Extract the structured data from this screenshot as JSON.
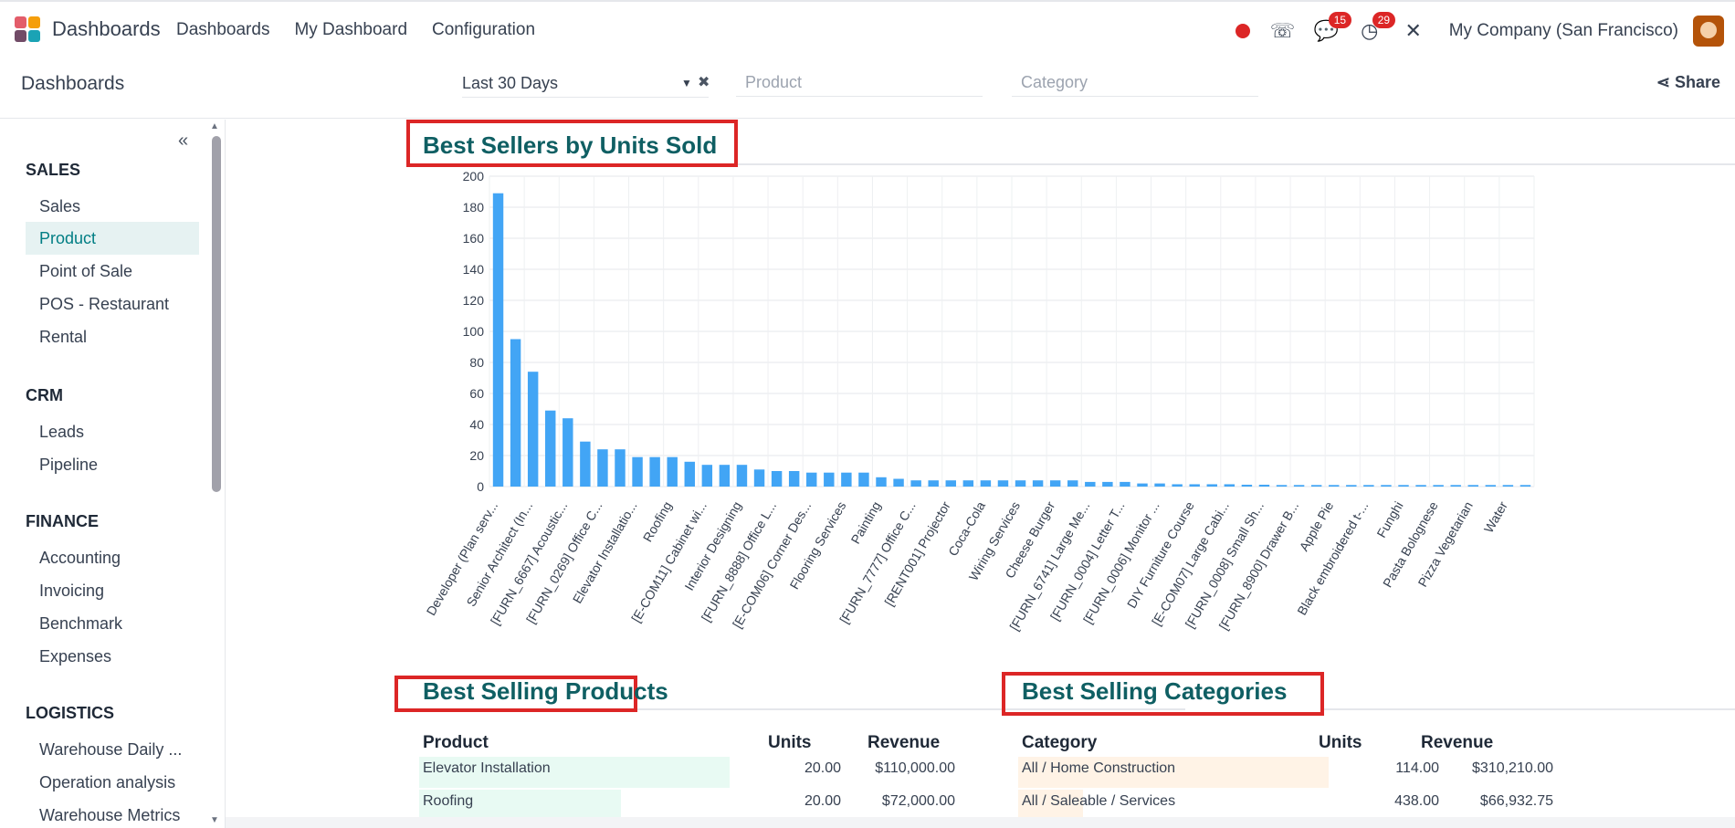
{
  "navbar": {
    "app_name": "Dashboards",
    "menu": [
      "Dashboards",
      "My Dashboard",
      "Configuration"
    ],
    "messages_badge": "15",
    "activities_badge": "29",
    "company": "My Company (San Francisco)"
  },
  "control": {
    "title": "Dashboards",
    "date_filter": "Last 30 Days",
    "product_placeholder": "Product",
    "category_placeholder": "Category",
    "share_label": "Share"
  },
  "sidebar": {
    "sections": [
      {
        "title": "SALES",
        "items": [
          "Sales",
          "Product",
          "Point of Sale",
          "POS - Restaurant",
          "Rental"
        ]
      },
      {
        "title": "CRM",
        "items": [
          "Leads",
          "Pipeline"
        ]
      },
      {
        "title": "FINANCE",
        "items": [
          "Accounting",
          "Invoicing",
          "Benchmark",
          "Expenses"
        ]
      },
      {
        "title": "LOGISTICS",
        "items": [
          "Warehouse Daily ...",
          "Operation analysis",
          "Warehouse Metrics"
        ]
      }
    ],
    "active_item": "Product"
  },
  "best_sellers": {
    "title": "Best Sellers by Units Sold"
  },
  "chart_data": {
    "type": "bar",
    "title": "Best Sellers by Units Sold",
    "ylim": [
      0,
      200
    ],
    "yticks": [
      0,
      20,
      40,
      60,
      80,
      100,
      120,
      140,
      160,
      180,
      200
    ],
    "color": "#42a5f5",
    "grid": true,
    "categories": [
      "Developer (Plan serv...",
      "Senior Architect (In...",
      "[FURN_6667] Acoustic...",
      "[FURN_0269] Office C...",
      "Elevator Installatio...",
      "Roofing",
      "[E-COM11] Cabinet wi...",
      "Interior Designing",
      "[FURN_8888] Office L...",
      "[E-COM06] Corner Des...",
      "Flooring Services",
      "Painting",
      "[FURN_7777] Office C...",
      "[RENT001] Projector",
      "Coca-Cola",
      "Wiring Services",
      "Cheese Burger",
      "[FURN_6741] Large Me...",
      "[FURN_0004] Letter T...",
      "[FURN_0006] Monitor ...",
      "DIY Furniture Course",
      "[E-COM07] Large Cabi...",
      "[FURN_0008] Small Sh...",
      "[FURN_8900] Drawer B...",
      "Apple Pie",
      "Black embroidered t-...",
      "Funghi",
      "Pasta Bolognese",
      "Pizza Vegetarian",
      "Water"
    ],
    "label_every": 2,
    "values": [
      189,
      95,
      74,
      49,
      44,
      29,
      24,
      24,
      19,
      19,
      19,
      16,
      14,
      14,
      14,
      11,
      10,
      10,
      9,
      9,
      9,
      9,
      6,
      5,
      4,
      4,
      4,
      4,
      4,
      4,
      4,
      4,
      4,
      4,
      3,
      3,
      3,
      2,
      2,
      1.5,
      1.5,
      1.5,
      1.5,
      1.2,
      1.2,
      1,
      1,
      1,
      1,
      1,
      1,
      1,
      1,
      1,
      1,
      1,
      1,
      1,
      1,
      1
    ]
  },
  "best_products": {
    "title": "Best Selling Products",
    "headers": [
      "Product",
      "Units",
      "Revenue"
    ],
    "rows": [
      {
        "name": "Elevator Installation",
        "units": "20.00",
        "revenue": "$110,000.00",
        "fill": 1.0
      },
      {
        "name": "Roofing",
        "units": "20.00",
        "revenue": "$72,000.00",
        "fill": 0.65
      }
    ]
  },
  "best_categories": {
    "title": "Best Selling Categories",
    "headers": [
      "Category",
      "Units",
      "Revenue"
    ],
    "rows": [
      {
        "name": "All / Home Construction",
        "units": "114.00",
        "revenue": "$310,210.00",
        "fill": 1.0
      },
      {
        "name": "All / Saleable / Services",
        "units": "438.00",
        "revenue": "$66,932.75",
        "fill": 0.21
      }
    ]
  },
  "colors": {
    "accent": "#017e84",
    "title": "#0f5f63",
    "highlight": "#dc2626",
    "products_bar": "#e8faf3",
    "categories_bar": "#fff3e6"
  }
}
